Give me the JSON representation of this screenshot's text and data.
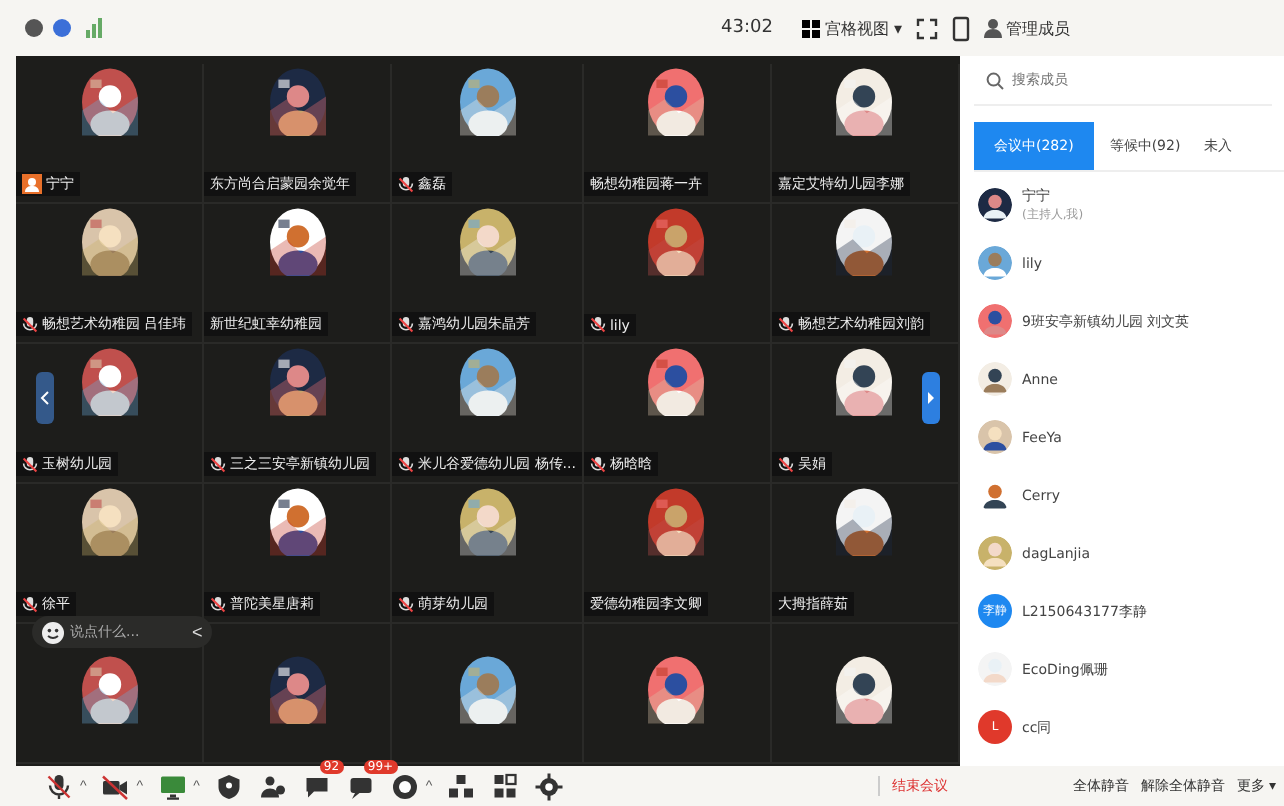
{
  "topbar": {
    "timer": "43:02",
    "view": "宫格视图",
    "view_caret": "▾",
    "members": "管理成员"
  },
  "tiles": [
    {
      "name": "宁宁",
      "kind": "host"
    },
    {
      "name": "东方尚合启蒙园余觉年",
      "kind": "plain"
    },
    {
      "name": "鑫磊",
      "kind": "mic"
    },
    {
      "name": "畅想幼稚园蒋一卉",
      "kind": "plain"
    },
    {
      "name": "嘉定艾特幼儿园李娜",
      "kind": "plain"
    },
    {
      "name": "畅想艺术幼稚园 吕佳玮",
      "kind": "mic"
    },
    {
      "name": "新世纪虹幸幼稚园",
      "kind": "plain"
    },
    {
      "name": "嘉鸿幼儿园朱晶芳",
      "kind": "mic"
    },
    {
      "name": "lily",
      "kind": "mic"
    },
    {
      "name": "畅想艺术幼稚园刘韵",
      "kind": "mic"
    },
    {
      "name": "玉树幼儿园",
      "kind": "mic"
    },
    {
      "name": "三之三安亭新镇幼儿园",
      "kind": "mic"
    },
    {
      "name": "米儿谷爱德幼儿园 杨传...",
      "kind": "mic"
    },
    {
      "name": "杨晗晗",
      "kind": "mic"
    },
    {
      "name": "吴娟",
      "kind": "mic"
    },
    {
      "name": "徐平",
      "kind": "mic"
    },
    {
      "name": "普陀美星唐莉",
      "kind": "mic"
    },
    {
      "name": "萌芽幼儿园",
      "kind": "mic"
    },
    {
      "name": "爱德幼稚园李文卿",
      "kind": "plain"
    },
    {
      "name": "大拇指薛茹",
      "kind": "plain"
    },
    {
      "kind": "picture"
    },
    {
      "kind": "picture"
    },
    {
      "kind": "picture"
    },
    {
      "kind": "picture"
    },
    {
      "kind": "picture"
    }
  ],
  "chat_bubble": {
    "placeholder": "说点什么...",
    "collapse": "<"
  },
  "panel": {
    "search": {
      "placeholder": "搜索成员"
    },
    "tabs": [
      {
        "label": "会议中(282)",
        "selected": true
      },
      {
        "label": "等候中(92)",
        "selected": false
      },
      {
        "label": "未入",
        "selected": false
      }
    ],
    "participants": [
      {
        "name": "宁宁",
        "note": "(主持人,我)",
        "kind": "picture"
      },
      {
        "name": "lily",
        "kind": "picture"
      },
      {
        "name": "9班安亭新镇幼儿园 刘文英",
        "kind": "picture"
      },
      {
        "name": "Anne",
        "kind": "picture"
      },
      {
        "name": "FeeYa",
        "kind": "picture"
      },
      {
        "name": "Cerry",
        "kind": "picture"
      },
      {
        "name": "dagLanjia",
        "kind": "picture"
      },
      {
        "name": "L2150643177李静",
        "kind": "letter",
        "letter": "李静",
        "color": "#1e88f0"
      },
      {
        "name": "EcoDing佩珊",
        "kind": "picture"
      },
      {
        "name": "cc同",
        "kind": "letter",
        "letter": "L",
        "color": "#e0392b"
      }
    ],
    "actions": [
      "全体静音",
      "解除全体静音",
      "更多 ▾"
    ]
  },
  "toolbar": {
    "tools": [
      {
        "kind": "mic",
        "caret": "^"
      },
      {
        "kind": "camera",
        "caret": "^"
      },
      {
        "kind": "screen",
        "caret": "^"
      },
      {
        "kind": "shield"
      },
      {
        "kind": "people"
      },
      {
        "kind": "chat",
        "badge": "92"
      },
      {
        "kind": "comment",
        "badge": "99+"
      },
      {
        "kind": "record",
        "caret": "^"
      },
      {
        "kind": "apps"
      },
      {
        "kind": "grid"
      },
      {
        "kind": "gear"
      }
    ],
    "end": "结束会议"
  }
}
